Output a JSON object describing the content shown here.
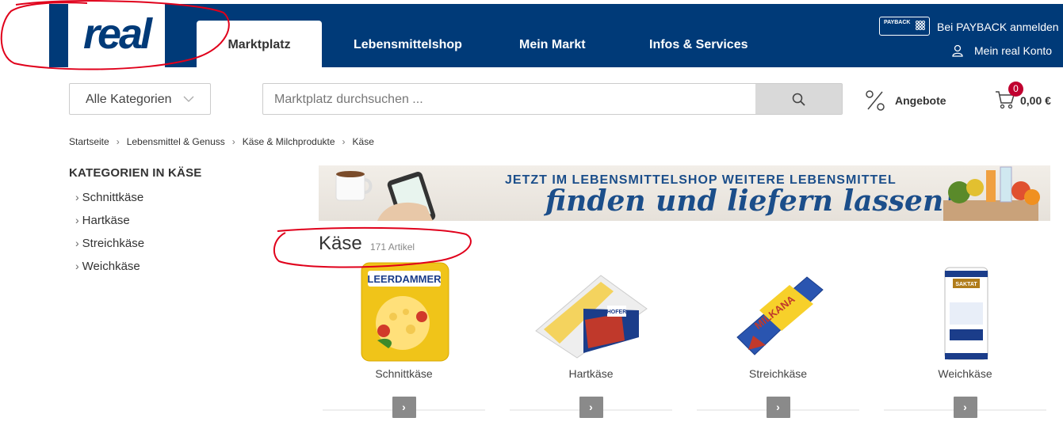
{
  "header": {
    "logo_text": "real",
    "nav_tabs": [
      {
        "label": "Marktplatz",
        "active": true
      },
      {
        "label": "Lebensmittelshop",
        "active": false
      },
      {
        "label": "Mein Markt",
        "active": false
      },
      {
        "label": "Infos & Services",
        "active": false
      }
    ],
    "payback_badge": "PAYBACK",
    "payback_link": "Bei PAYBACK anmelden",
    "account_link": "Mein real Konto"
  },
  "search_bar": {
    "category_select": "Alle Kategorien",
    "placeholder": "Marktplatz durchsuchen ...",
    "offers_label": "Angebote",
    "cart_count": "0",
    "cart_total": "0,00 €"
  },
  "breadcrumb": [
    "Startseite",
    "Lebensmittel & Genuss",
    "Käse & Milchprodukte",
    "Käse"
  ],
  "sidebar": {
    "title": "KATEGORIEN IN KÄSE",
    "items": [
      {
        "label": "Schnittkäse"
      },
      {
        "label": "Hartkäse"
      },
      {
        "label": "Streichkäse"
      },
      {
        "label": "Weichkäse"
      }
    ]
  },
  "banner": {
    "line1": "JETZT IM LEBENSMITTELSHOP WEITERE LEBENSMITTEL",
    "line2": "finden und liefern lassen!"
  },
  "main": {
    "title": "Käse",
    "count": "171 Artikel",
    "products": [
      {
        "label": "Schnittkäse",
        "brand": "LEERDAMMER"
      },
      {
        "label": "Hartkäse",
        "brand": "HOFER"
      },
      {
        "label": "Streichkäse",
        "brand": "MILKANA"
      },
      {
        "label": "Weichkäse",
        "brand": "SAKTAT"
      }
    ]
  },
  "colors": {
    "brand_blue": "#003a78",
    "cart_badge": "#c0002f",
    "annotation_red": "#e0001b"
  }
}
